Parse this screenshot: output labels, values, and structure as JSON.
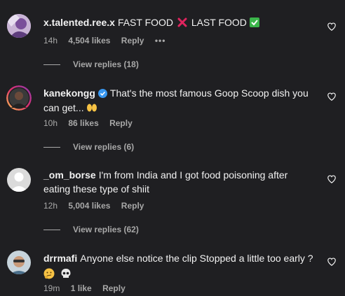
{
  "comments": [
    {
      "user": "x.talented.ree.x",
      "text_a": "FAST FOOD",
      "text_b": "LAST FOOD",
      "time": "14h",
      "likes": "4,504 likes",
      "reply": "Reply",
      "more": "•••",
      "view_replies": "View replies (18)"
    },
    {
      "user": "kanekongg",
      "text": "That's the most famous Goop Scoop dish you can get...",
      "time": "10h",
      "likes": "86 likes",
      "reply": "Reply",
      "view_replies": "View replies (6)"
    },
    {
      "user": "_om_borse",
      "text": "I'm from India and I got food poisoning after eating these type of shiit",
      "time": "12h",
      "likes": "5,004 likes",
      "reply": "Reply",
      "view_replies": "View replies (62)"
    },
    {
      "user": "drrmafi",
      "text": "Anyone else notice the clip Stopped a little too early ?",
      "time": "19m",
      "likes": "1 like",
      "reply": "Reply"
    }
  ],
  "icons": {
    "cross": "cross-mark-emoji",
    "check": "check-mark-emoji",
    "raised_hands": "raised-hands-emoji",
    "thinking": "thinking-face-emoji",
    "skull": "skull-emoji",
    "heart": "heart-outline-icon",
    "verified": "verified-badge-icon"
  },
  "colors": {
    "background": "#1f1f22",
    "text": "#f5f5f5",
    "secondary": "#a8a8a8",
    "verified": "#3897f0",
    "cross": "#e0245e",
    "check": "#3bb54a"
  }
}
